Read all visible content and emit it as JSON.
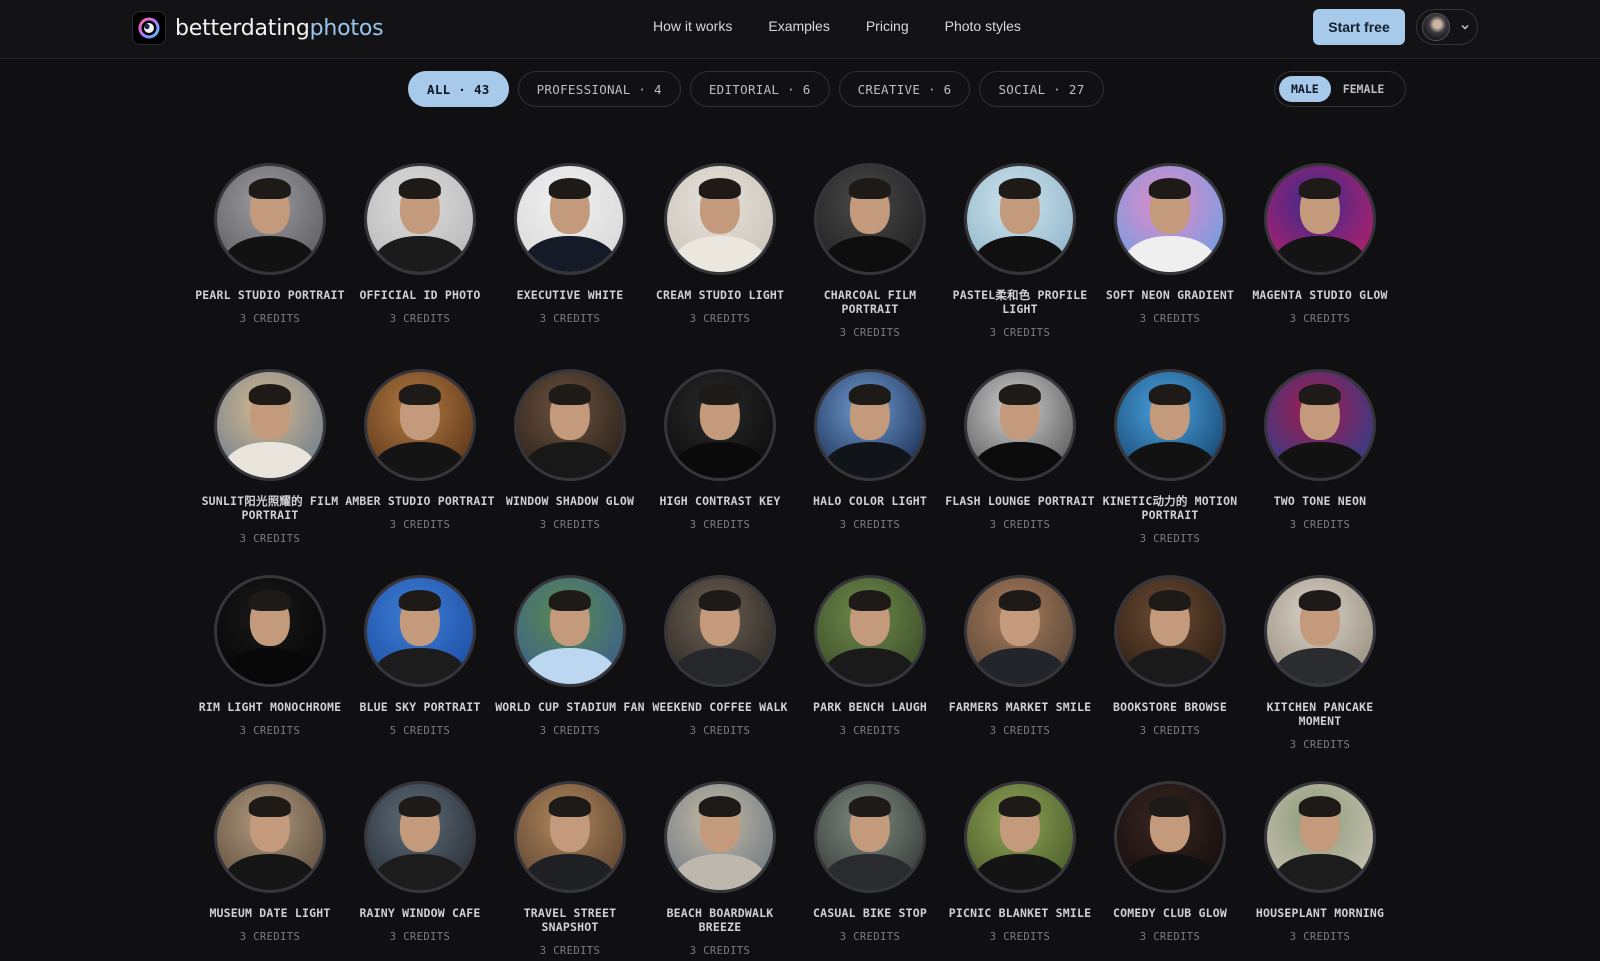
{
  "header": {
    "brand_main": "betterdating",
    "brand_accent": "photos",
    "nav": [
      "How it works",
      "Examples",
      "Pricing",
      "Photo styles"
    ],
    "start_label": "Start free",
    "avatar_icon": "user-avatar-icon",
    "dropdown_icon": "chevron-down-icon"
  },
  "filters": [
    {
      "label": "ALL · 43",
      "active": true
    },
    {
      "label": "PROFESSIONAL · 4",
      "active": false
    },
    {
      "label": "EDITORIAL · 6",
      "active": false
    },
    {
      "label": "CREATIVE · 6",
      "active": false
    },
    {
      "label": "SOCIAL · 27",
      "active": false
    }
  ],
  "gender": {
    "male": "MALE",
    "female": "FEMALE",
    "selected": "MALE"
  },
  "colors": {
    "accent": "#a7c9ea",
    "background": "#101012"
  },
  "styles": [
    {
      "title": "PEARL STUDIO PORTRAIT",
      "credits": "3 CREDITS",
      "bg": [
        "#9c9ca0",
        "#5d5d62"
      ],
      "shirt": "#121212"
    },
    {
      "title": "OFFICIAL ID PHOTO",
      "credits": "3 CREDITS",
      "bg": [
        "#dcdcdc",
        "#b9b9bb"
      ],
      "shirt": "#1b1b1b"
    },
    {
      "title": "EXECUTIVE WHITE",
      "credits": "3 CREDITS",
      "bg": [
        "#f1f1f1",
        "#d8d8d8"
      ],
      "shirt": "#141a26"
    },
    {
      "title": "CREAM STUDIO LIGHT",
      "credits": "3 CREDITS",
      "bg": [
        "#e6e1da",
        "#cbc4b9"
      ],
      "shirt": "#ebe6de"
    },
    {
      "title": "CHARCOAL FILM PORTRAIT",
      "credits": "3 CREDITS",
      "bg": [
        "#4a4a4a",
        "#1f1f1f"
      ],
      "shirt": "#0e0e0e"
    },
    {
      "title": "PASTEL柔和色 PROFILE LIGHT",
      "credits": "3 CREDITS",
      "bg": [
        "#cfe4ef",
        "#8fb5c9"
      ],
      "shirt": "#101010"
    },
    {
      "title": "SOFT NEON GRADIENT",
      "credits": "3 CREDITS",
      "bg": [
        "#e489c6",
        "#6f9fe4"
      ],
      "shirt": "#efefef"
    },
    {
      "title": "MAGENTA STUDIO GLOW",
      "credits": "3 CREDITS",
      "bg": [
        "#3a2b8c",
        "#b51f6a"
      ],
      "shirt": "#141414"
    },
    {
      "title": "SUNLIT阳光照耀的 FILM PORTRAIT",
      "credits": "3 CREDITS",
      "bg": [
        "#d6b98c",
        "#6e7e92"
      ],
      "shirt": "#e9e4dc"
    },
    {
      "title": "AMBER STUDIO PORTRAIT",
      "credits": "3 CREDITS",
      "bg": [
        "#b47a44",
        "#5a3517"
      ],
      "shirt": "#141414"
    },
    {
      "title": "WINDOW SHADOW GLOW",
      "credits": "3 CREDITS",
      "bg": [
        "#6b5340",
        "#2a2018"
      ],
      "shirt": "#181818"
    },
    {
      "title": "HIGH CONTRAST KEY",
      "credits": "3 CREDITS",
      "bg": [
        "#2a2a2a",
        "#0c0c0c"
      ],
      "shirt": "#0a0a0a"
    },
    {
      "title": "HALO COLOR LIGHT",
      "credits": "3 CREDITS",
      "bg": [
        "#6f9bd0",
        "#1b2f55"
      ],
      "shirt": "#111418"
    },
    {
      "title": "FLASH LOUNGE PORTRAIT",
      "credits": "3 CREDITS",
      "bg": [
        "#cfcfcf",
        "#5a5a5a"
      ],
      "shirt": "#0c0c0c"
    },
    {
      "title": "KINETIC动力的 MOTION PORTRAIT",
      "credits": "3 CREDITS",
      "bg": [
        "#4aa3e0",
        "#16456f"
      ],
      "shirt": "#121212"
    },
    {
      "title": "TWO TONE NEON",
      "credits": "3 CREDITS",
      "bg": [
        "#a21a4c",
        "#2d3f8a"
      ],
      "shirt": "#121212"
    },
    {
      "title": "RIM LIGHT MONOCHROME",
      "credits": "3 CREDITS",
      "bg": [
        "#1a1a1a",
        "#050505"
      ],
      "shirt": "#080808"
    },
    {
      "title": "BLUE SKY PORTRAIT",
      "credits": "5 CREDITS",
      "bg": [
        "#3f7ed6",
        "#1c4ea3"
      ],
      "shirt": "#1c1c1c"
    },
    {
      "title": "WORLD CUP STADIUM FAN",
      "credits": "3 CREDITS",
      "bg": [
        "#5a8a4f",
        "#3a5f8c"
      ],
      "shirt": "#bcd7f0"
    },
    {
      "title": "WEEKEND COFFEE WALK",
      "credits": "3 CREDITS",
      "bg": [
        "#6d6053",
        "#2d2925"
      ],
      "shirt": "#26272b"
    },
    {
      "title": "PARK BENCH LAUGH",
      "credits": "3 CREDITS",
      "bg": [
        "#6e8a4c",
        "#3a4c28"
      ],
      "shirt": "#1a1a1a"
    },
    {
      "title": "FARMERS MARKET SMILE",
      "credits": "3 CREDITS",
      "bg": [
        "#a77b5b",
        "#5a4737"
      ],
      "shirt": "#22252b"
    },
    {
      "title": "BOOKSTORE BROWSE",
      "credits": "3 CREDITS",
      "bg": [
        "#6b4b33",
        "#2c1d13"
      ],
      "shirt": "#1a1a1a"
    },
    {
      "title": "KITCHEN PANCAKE MOMENT",
      "credits": "3 CREDITS",
      "bg": [
        "#d8d2c7",
        "#9a8f80"
      ],
      "shirt": "#2a2c30"
    },
    {
      "title": "MUSEUM DATE LIGHT",
      "credits": "3 CREDITS",
      "bg": [
        "#b19a7d",
        "#5e4f3f"
      ],
      "shirt": "#151515"
    },
    {
      "title": "RAINY WINDOW CAFE",
      "credits": "3 CREDITS",
      "bg": [
        "#5e6c78",
        "#2a3038"
      ],
      "shirt": "#1c1c1c"
    },
    {
      "title": "TRAVEL STREET SNAPSHOT",
      "credits": "3 CREDITS",
      "bg": [
        "#b0875c",
        "#5c4330"
      ],
      "shirt": "#1f2024"
    },
    {
      "title": "BEACH BOARDWALK BREEZE",
      "credits": "3 CREDITS",
      "bg": [
        "#c4b9a4",
        "#6f7a84"
      ],
      "shirt": "#bdb7ad"
    },
    {
      "title": "CASUAL BIKE STOP",
      "credits": "3 CREDITS",
      "bg": [
        "#7d8a80",
        "#363c38"
      ],
      "shirt": "#2a2b2e"
    },
    {
      "title": "PICNIC BLANKET SMILE",
      "credits": "3 CREDITS",
      "bg": [
        "#8fa456",
        "#4a5b2a"
      ],
      "shirt": "#141414"
    },
    {
      "title": "COMEDY CLUB GLOW",
      "credits": "3 CREDITS",
      "bg": [
        "#3b2622",
        "#130d0c"
      ],
      "shirt": "#101010"
    },
    {
      "title": "HOUSEPLANT MORNING",
      "credits": "3 CREDITS",
      "bg": [
        "#8c9b78",
        "#c9c2b3"
      ],
      "shirt": "#1c1c1c"
    }
  ]
}
